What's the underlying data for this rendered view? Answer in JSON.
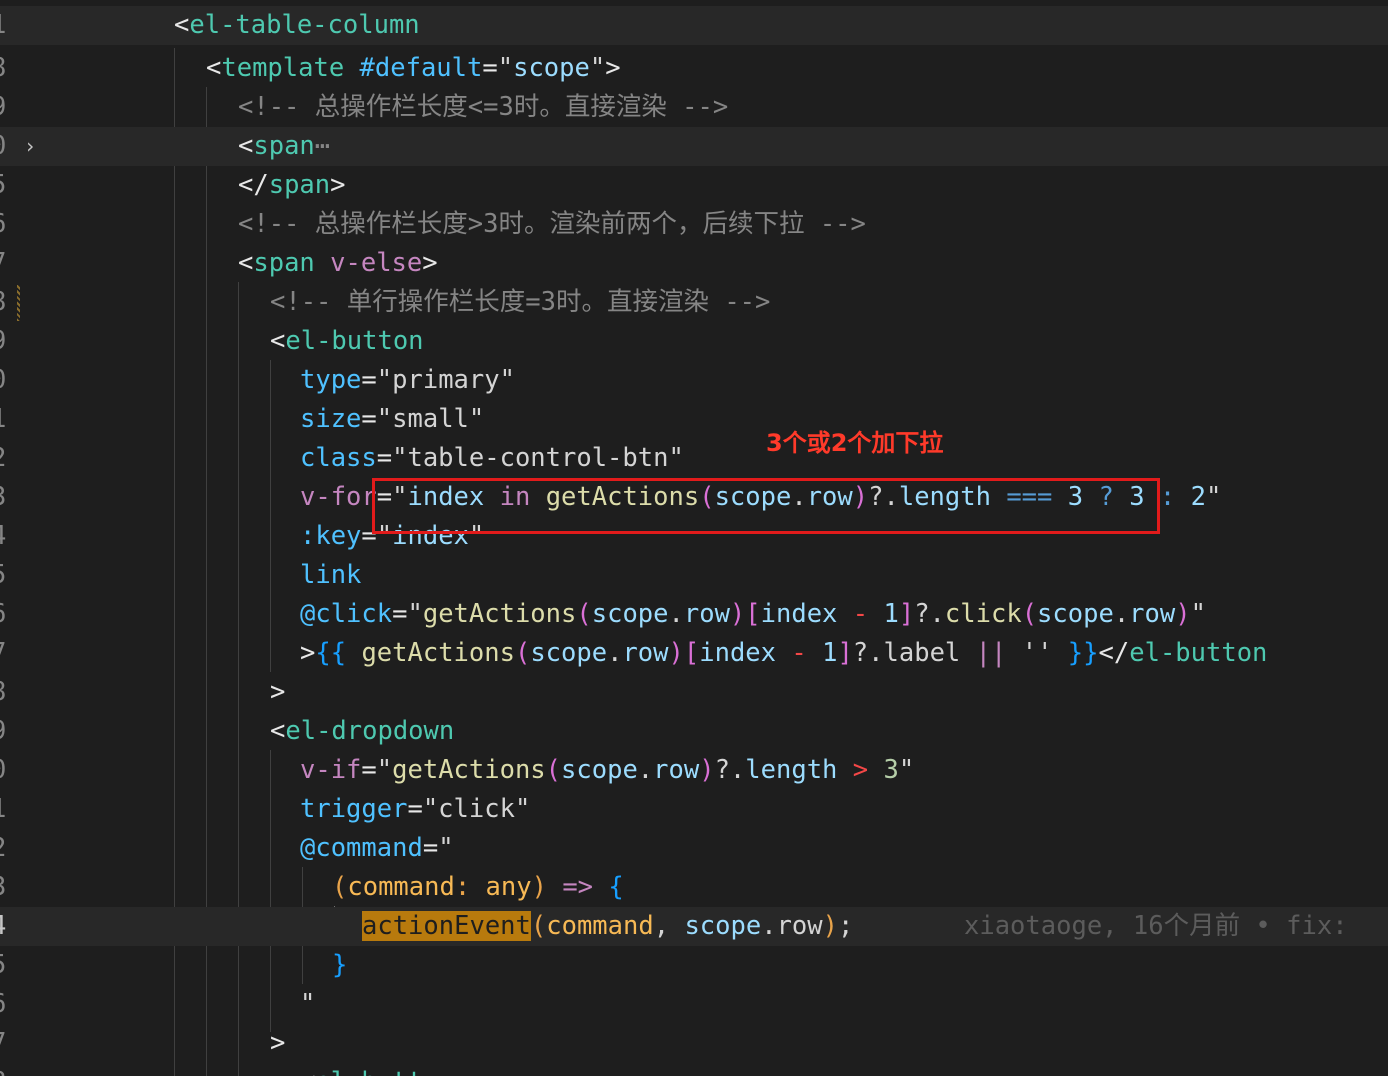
{
  "editor": {
    "annotation_label": "3个或2个加下拉",
    "blame_text": "xiaotaoge, 16个月前 • fix:",
    "folded_marker": "⋯",
    "lines": [
      {
        "num": "1",
        "text": "<el-table-column"
      },
      {
        "num": "8",
        "text": "<template #default=\"scope\">"
      },
      {
        "num": "9",
        "text": "<!-- 总操作栏长度<=3时。直接渲染 -->"
      },
      {
        "num": "0",
        "text": "<span"
      },
      {
        "num": "5",
        "text": "</span>"
      },
      {
        "num": "6",
        "text": "<!-- 总操作栏长度>3时。渲染前两个，后续下拉 -->"
      },
      {
        "num": "7",
        "text": "<span v-else>"
      },
      {
        "num": "8",
        "text": "<!-- 单行操作栏长度=3时。直接渲染 -->"
      },
      {
        "num": "9",
        "text": "<el-button"
      },
      {
        "num": "0",
        "text": "type=\"primary\""
      },
      {
        "num": "1",
        "text": "size=\"small\""
      },
      {
        "num": "2",
        "text": "class=\"table-control-btn\""
      },
      {
        "num": "3",
        "text": "v-for=\"index in getActions(scope.row)?.length === 3 ? 3 : 2\""
      },
      {
        "num": "4",
        "text": ":key=\"index\""
      },
      {
        "num": "5",
        "text": "link"
      },
      {
        "num": "6",
        "text": "@click=\"getActions(scope.row)[index - 1]?.click(scope.row)\""
      },
      {
        "num": "7",
        "text": ">{{ getActions(scope.row)[index - 1]?.label || '' }}</el-button"
      },
      {
        "num": "8",
        "text": ">"
      },
      {
        "num": "9",
        "text": "<el-dropdown"
      },
      {
        "num": "0",
        "text": "v-if=\"getActions(scope.row)?.length > 3\""
      },
      {
        "num": "1",
        "text": "trigger=\"click\""
      },
      {
        "num": "2",
        "text": "@command=\""
      },
      {
        "num": "3",
        "text": "(command: any) => {"
      },
      {
        "num": "4",
        "text": "actionEvent(command, scope.row);"
      },
      {
        "num": "5",
        "text": "}"
      },
      {
        "num": "6",
        "text": "\""
      },
      {
        "num": "7",
        "text": ">"
      },
      {
        "num": "8",
        "text": "<el-butt"
      }
    ]
  }
}
